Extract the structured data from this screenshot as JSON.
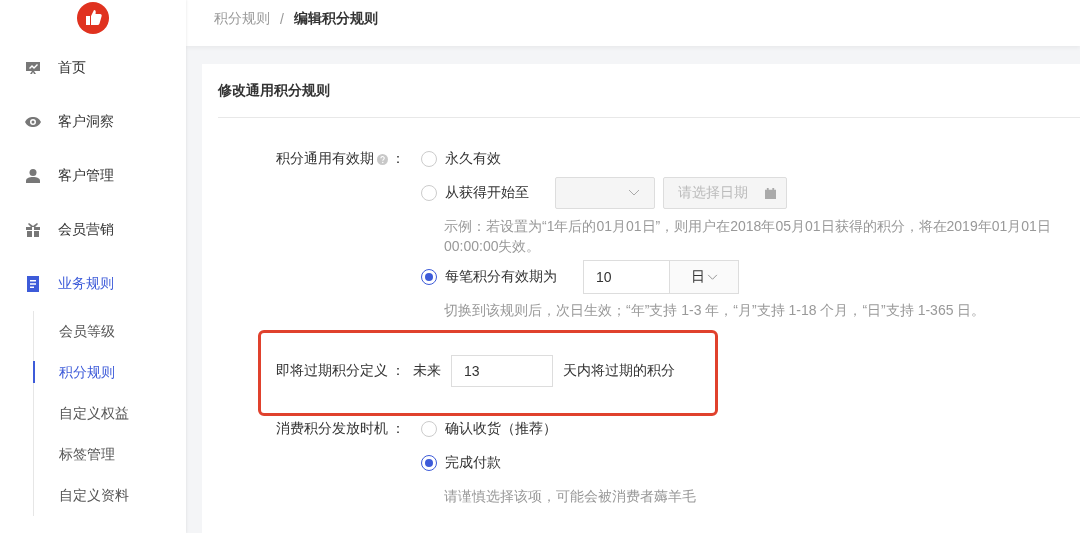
{
  "sidebar": {
    "items": [
      {
        "label": "首页",
        "kind": "home",
        "selected": false
      },
      {
        "label": "客户洞察",
        "kind": "eye",
        "selected": false
      },
      {
        "label": "客户管理",
        "kind": "person",
        "selected": false
      },
      {
        "label": "会员营销",
        "kind": "gift",
        "selected": false
      },
      {
        "label": "业务规则",
        "kind": "document",
        "selected": true,
        "children": [
          {
            "label": "会员等级",
            "selected": false
          },
          {
            "label": "积分规则",
            "selected": true
          },
          {
            "label": "自定义权益",
            "selected": false
          },
          {
            "label": "标签管理",
            "selected": false
          },
          {
            "label": "自定义资料",
            "selected": false
          }
        ]
      }
    ]
  },
  "breadcrumb": {
    "items": [
      {
        "label": "积分规则",
        "current": false
      },
      {
        "label": "编辑积分规则",
        "current": true
      }
    ],
    "separator": "/"
  },
  "card": {
    "title": "修改通用积分规则",
    "fields": [
      {
        "kind": "radios",
        "label": "积分通用有效期",
        "help": true,
        "colon": "：",
        "options": [
          {
            "kind": "plain",
            "label": "永久有效",
            "selected": false
          },
          {
            "kind": "date",
            "label": "从获得开始至",
            "selected": false,
            "date_placeholder": "请选择日期",
            "hint": "示例：若设置为“1年后的01月01日”，则用户在2018年05月01日获得的积分，将在2019年01月01日 00:00:00失效。"
          },
          {
            "kind": "number",
            "label": "每笔积分有效期为",
            "selected": true,
            "value": "10",
            "unit": "日",
            "hint": "切换到该规则后，次日生效；“年”支持 1-3 年，“月”支持 1-18 个月，“日”支持 1-365 日。"
          }
        ]
      },
      {
        "kind": "inline",
        "label": "即将过期积分定义",
        "colon": "：",
        "highlighted": true,
        "prefix": "未来",
        "value": "13",
        "suffix": "天内将过期的积分"
      },
      {
        "kind": "radios",
        "label": "消费积分发放时机",
        "colon": "：",
        "options": [
          {
            "kind": "plain",
            "label": "确认收货（推荐）",
            "selected": false
          },
          {
            "kind": "plain",
            "label": "完成付款",
            "selected": true,
            "hint": "请谨慎选择该项，可能会被消费者薅羊毛"
          }
        ]
      }
    ]
  }
}
